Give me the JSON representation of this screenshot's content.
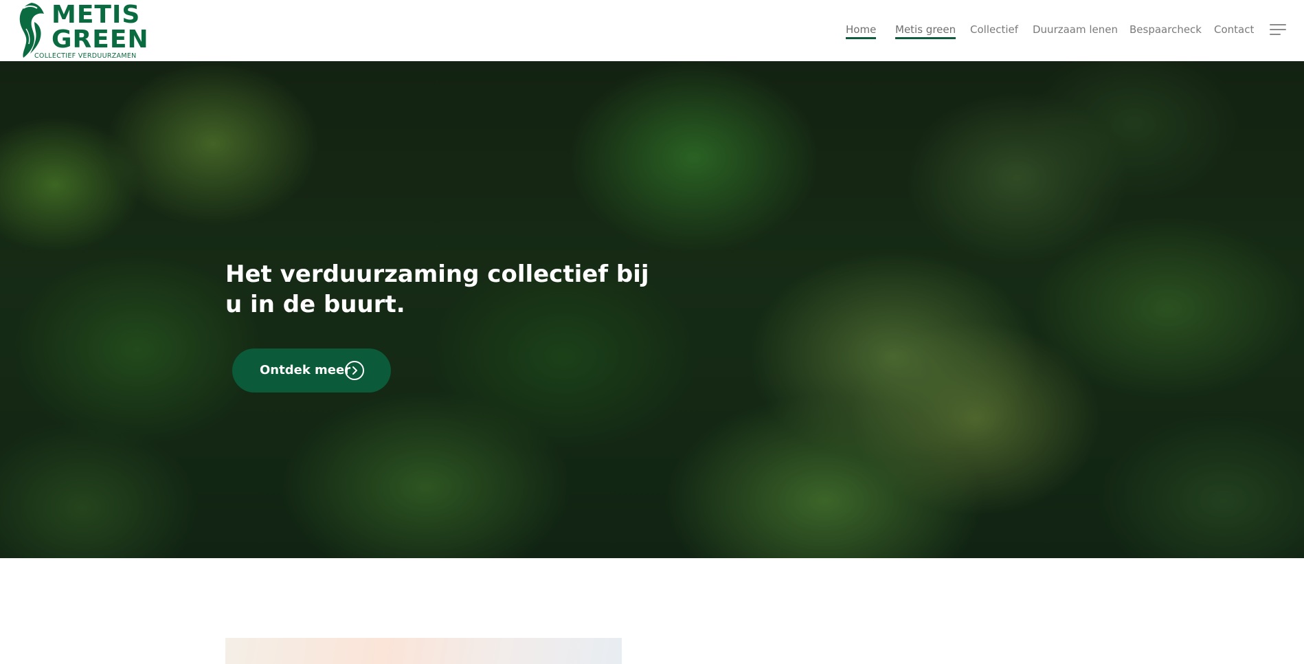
{
  "brand": {
    "logo_line1": "METIS",
    "logo_line2": "GREEN",
    "tagline": "COLLECTIEF VERDUURZAMEN",
    "color": "#0a6b40",
    "icon": "helmet-leaf-logo-icon"
  },
  "nav": {
    "items": [
      {
        "label": "Home",
        "active": true
      },
      {
        "label": "Metis green",
        "active": true
      },
      {
        "label": "Collectief",
        "active": false
      },
      {
        "label": "Duurzaam lenen",
        "active": false
      },
      {
        "label": "Bespaarcheck",
        "active": false
      },
      {
        "label": "Contact",
        "active": false
      }
    ],
    "menu_icon": "hamburger-menu-icon",
    "underline_color": "#0e5c3c"
  },
  "hero": {
    "title": "Het verduurzaming collectief bij u in de buurt.",
    "button_label": "Ontdek meer",
    "button_icon": "chevron-right-circle-icon",
    "button_color": "#0b5a3a",
    "background": "aerial forest canopy photo"
  }
}
